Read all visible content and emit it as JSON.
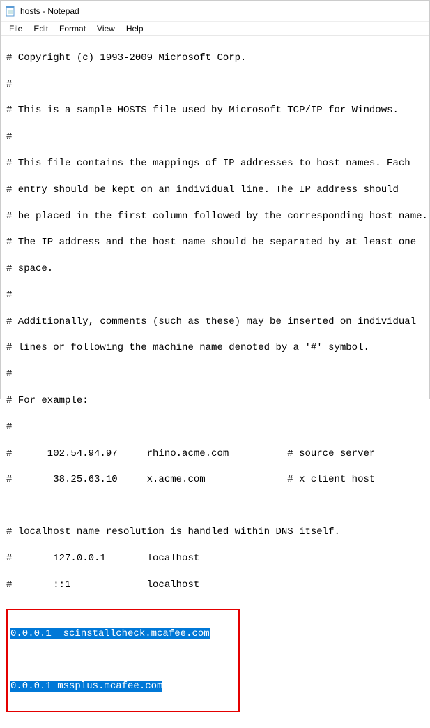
{
  "titlebar": {
    "title": "hosts - Notepad"
  },
  "menu": {
    "file": "File",
    "edit": "Edit",
    "format": "Format",
    "view": "View",
    "help": "Help"
  },
  "document": {
    "lines": [
      "# Copyright (c) 1993-2009 Microsoft Corp.",
      "#",
      "# This is a sample HOSTS file used by Microsoft TCP/IP for Windows.",
      "#",
      "# This file contains the mappings of IP addresses to host names. Each",
      "# entry should be kept on an individual line. The IP address should",
      "# be placed in the first column followed by the corresponding host name.",
      "# The IP address and the host name should be separated by at least one",
      "# space.",
      "#",
      "# Additionally, comments (such as these) may be inserted on individual",
      "# lines or following the machine name denoted by a '#' symbol.",
      "#",
      "# For example:",
      "#",
      "#      102.54.94.97     rhino.acme.com          # source server",
      "#       38.25.63.10     x.acme.com              # x client host",
      "",
      "# localhost name resolution is handled within DNS itself.",
      "#       127.0.0.1       localhost",
      "#       ::1             localhost"
    ],
    "highlighted": {
      "line1": "0.0.0.1  scinstallcheck.mcafee.com",
      "line2": "0.0.0.1 mssplus.mcafee.com"
    }
  }
}
